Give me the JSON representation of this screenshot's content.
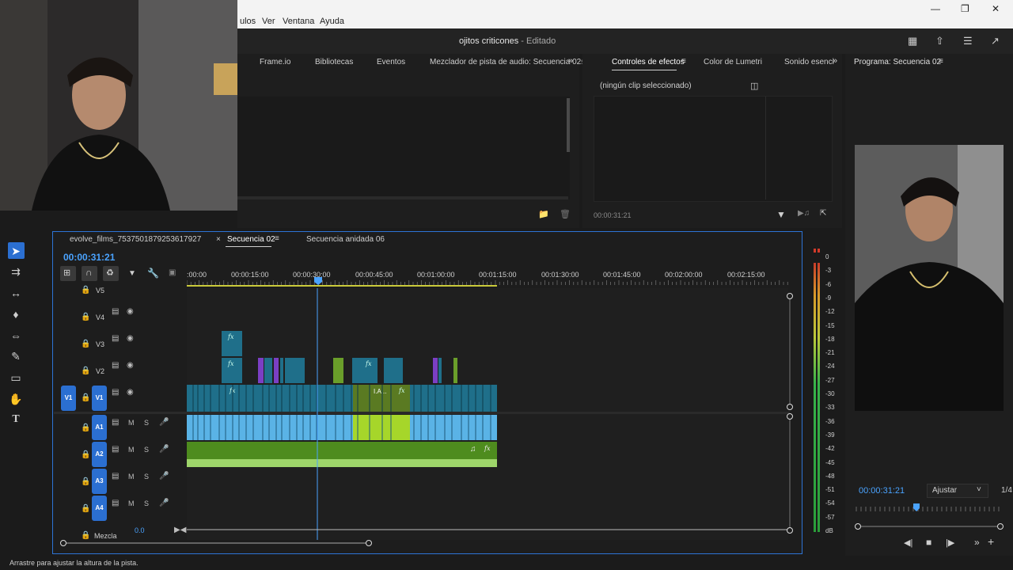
{
  "menu": {
    "items": [
      "ulos",
      "Ver",
      "Ventana",
      "Ayuda"
    ]
  },
  "window": {
    "title": "ojitos criticones",
    "edited": " - Editado"
  },
  "source_panel": {
    "tabs": [
      "Frame.io",
      "Bibliotecas",
      "Eventos",
      "Mezclador de pista de audio: Secuencia 02",
      "s"
    ]
  },
  "effects_panel": {
    "tabs": [
      "Controles de efectos",
      "Color de Lumetri",
      "Sonido esenci"
    ],
    "empty_msg": "(ningún clip seleccionado)",
    "timecode": "00:00:31:21"
  },
  "program_monitor": {
    "title": "Programa: Secuencia 02",
    "timecode": "00:00:31:21",
    "fit": "Ajustar",
    "resolution": "1/4"
  },
  "timeline": {
    "tabs": [
      "evolve_films_7537501879253617927",
      "Secuencia 02",
      "Secuencia anidada 06"
    ],
    "timecode": "00:00:31:21",
    "ruler": [
      ":00:00",
      "00:00:15:00",
      "00:00:30:00",
      "00:00:45:00",
      "00:01:00:00",
      "00:01:15:00",
      "00:01:30:00",
      "00:01:45:00",
      "00:02:00:00",
      "00:02:15:00"
    ],
    "video_tracks": [
      "V5",
      "V4",
      "V3",
      "V2",
      "V1"
    ],
    "audio_tracks": [
      "A1",
      "A2",
      "A3",
      "A4"
    ],
    "source_patch": "V1",
    "mix_label": "Mezcla",
    "mix_value": "0.0",
    "m_label": "M",
    "s_label": "S",
    "fx": "fx",
    "clip_label": "I.A..."
  },
  "vu_meter": {
    "labels": [
      "0",
      "-3",
      "-6",
      "-9",
      "-12",
      "-15",
      "-18",
      "-21",
      "-24",
      "-27",
      "-30",
      "-33",
      "-36",
      "-39",
      "-42",
      "-45",
      "-48",
      "-51",
      "-54",
      "-57",
      "dB"
    ]
  },
  "status": {
    "text": "Arrastre para ajustar la altura de la pista."
  },
  "colors": {
    "accent": "#2b6fd1",
    "video_clip": "#1f6f8a",
    "audio_clip_blue": "#5ab3e6",
    "audio_clip_green": "#6a9e2a",
    "playhead": "#4aa3ff"
  }
}
